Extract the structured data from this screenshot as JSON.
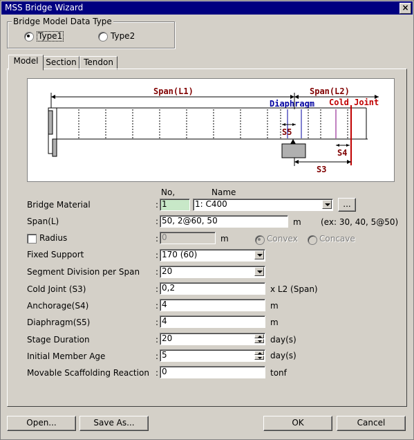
{
  "window": {
    "title": "MSS Bridge Wizard",
    "close_glyph": "×"
  },
  "datatype": {
    "legend": "Bridge Model Data Type",
    "type1": "Type1",
    "type2": "Type2",
    "selected": "Type1"
  },
  "tabs": [
    "Model",
    "Section",
    "Tendon"
  ],
  "diagram": {
    "span_l1": "Span(L1)",
    "span_l2": "Span(L2)",
    "diaphragm": "Diaphragm",
    "cold_joint": "Cold Joint",
    "s5": "S5",
    "s4": "S4",
    "s3": "S3"
  },
  "form": {
    "col_no": "No,",
    "col_name": "Name",
    "material_label": "Bridge Material",
    "material_no": "1",
    "material_name": "1: C400",
    "browse": "...",
    "span_label": "Span(L)",
    "span_value": "50, 2@60, 50",
    "span_unit": "m",
    "span_example": "(ex: 30, 40, 5@50)",
    "radius_label": "Radius",
    "radius_value": "0",
    "radius_unit": "m",
    "convex": "Convex",
    "concave": "Concave",
    "fixed_label": "Fixed Support",
    "fixed_value": "170 (60)",
    "segdiv_label": "Segment Division per Span",
    "segdiv_value": "20",
    "cold_label": "Cold Joint (S3)",
    "cold_value": "0,2",
    "cold_unit": "x L2 (Span)",
    "anch_label": "Anchorage(S4)",
    "anch_value": "4",
    "anch_unit": "m",
    "dia_label": "Diaphragm(S5)",
    "dia_value": "4",
    "dia_unit": "m",
    "stage_label": "Stage Duration",
    "stage_value": "20",
    "stage_unit": "day(s)",
    "age_label": "Initial Member Age",
    "age_value": "5",
    "age_unit": "day(s)",
    "msr_label": "Movable Scaffolding Reaction",
    "msr_value": "0",
    "msr_unit": "tonf",
    "colon": ":"
  },
  "buttons": {
    "open": "Open...",
    "saveas": "Save As...",
    "ok": "OK",
    "cancel": "Cancel"
  },
  "colors": {
    "title_bar": "#000080",
    "dark_red": "#800000",
    "blue": "#0000a0",
    "red": "#c00000"
  }
}
